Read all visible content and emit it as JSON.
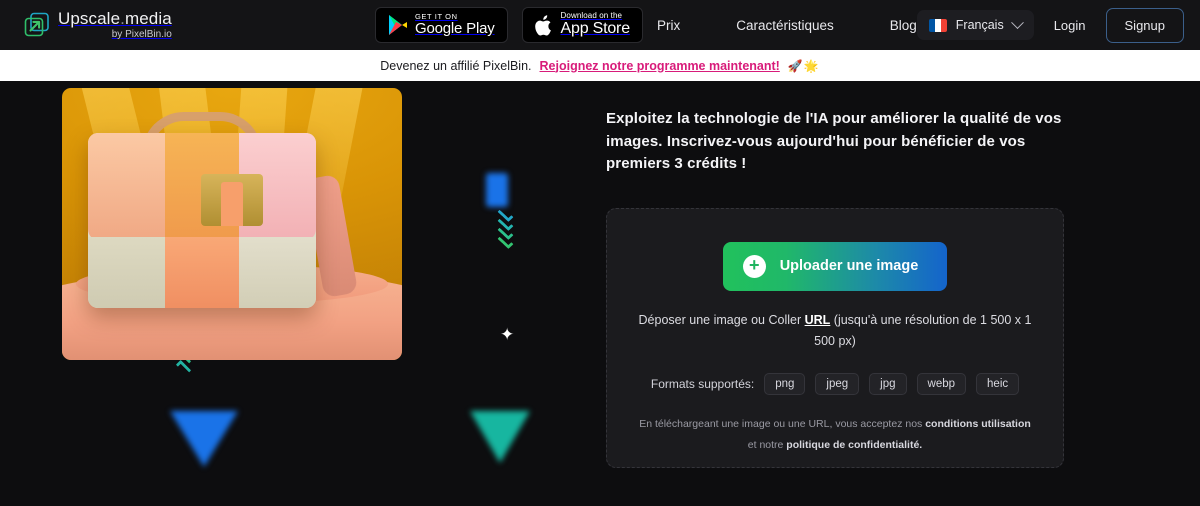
{
  "header": {
    "brand": {
      "name": "Upscale",
      "dot": ".",
      "suffix": "media",
      "byline": "by PixelBin.io",
      "logo_icon": "upscale-arrow-logo"
    },
    "store_badges": [
      {
        "small": "GET IT ON",
        "big": "Google Play",
        "icon": "google-play-icon"
      },
      {
        "small": "Download on the",
        "big": "App Store",
        "icon": "apple-icon"
      }
    ],
    "nav": [
      {
        "label": "Prix"
      },
      {
        "label": "Caractéristiques"
      },
      {
        "label": "Blog"
      }
    ],
    "language": {
      "label": "Français",
      "flag": "french-flag-icon",
      "chevron": "chevron-down-icon"
    },
    "login_label": "Login",
    "signup_label": "Signup"
  },
  "banner": {
    "text": "Devenez un affilié PixelBin.",
    "cta": "Rejoignez notre programme maintenant!",
    "emoji": "🚀🌟"
  },
  "main": {
    "headline": "Exploitez la technologie de l'IA pour améliorer la qualité de vos images. Inscrivez-vous aujourd'hui pour bénéficier de vos premiers 3 crédits !",
    "visual": {
      "alt": "handbag-product-photo",
      "decor": [
        "star",
        "star",
        "chevron-stack-up",
        "chevron-stack-down",
        "triangle-blue",
        "triangle-teal"
      ]
    },
    "upload": {
      "button_label": "Uploader une image",
      "plus_icon": "plus-circle-icon",
      "drop_prefix": "Déposer une image ou Coller ",
      "drop_url": "URL",
      "drop_suffix": " (jusqu'à une résolution de 1 500 x 1 500 px)",
      "formats_label": "Formats supportés:",
      "formats": [
        "png",
        "jpeg",
        "jpg",
        "webp",
        "heic"
      ],
      "legal_prefix": "En téléchargeant une image ou une URL, vous acceptez nos ",
      "legal_terms": "conditions utilisation",
      "legal_mid": " et notre ",
      "legal_privacy": "politique de confidentialité."
    }
  },
  "colors": {
    "page_bg": "#0d0d0f",
    "header_bg": "#141416",
    "banner_bg": "#ffffff",
    "banner_link": "#d81b7a",
    "upload_gradient_start": "#21c15c",
    "upload_gradient_end": "#1464cc",
    "card_bg": "#1b1b1e"
  }
}
